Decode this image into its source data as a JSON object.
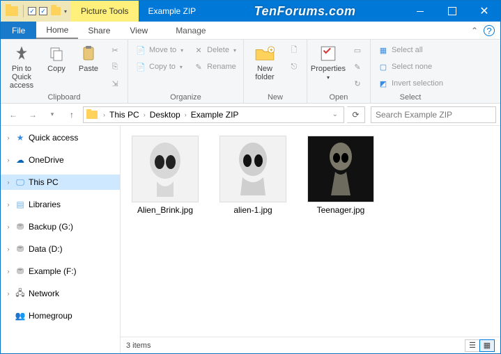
{
  "title": "Example ZIP",
  "context_tab": "Picture Tools",
  "watermark": "TenForums.com",
  "tabs": {
    "file": "File",
    "home": "Home",
    "share": "Share",
    "view": "View",
    "manage": "Manage"
  },
  "ribbon": {
    "clipboard": {
      "label": "Clipboard",
      "pin": "Pin to Quick\naccess",
      "copy": "Copy",
      "paste": "Paste"
    },
    "organize": {
      "label": "Organize",
      "move": "Move to",
      "copy": "Copy to",
      "delete": "Delete",
      "rename": "Rename"
    },
    "new": {
      "label": "New",
      "folder": "New\nfolder"
    },
    "open": {
      "label": "Open",
      "properties": "Properties"
    },
    "select": {
      "label": "Select",
      "all": "Select all",
      "none": "Select none",
      "invert": "Invert selection"
    }
  },
  "breadcrumb": [
    "This PC",
    "Desktop",
    "Example ZIP"
  ],
  "search_placeholder": "Search Example ZIP",
  "nav": [
    {
      "label": "Quick access",
      "icon": "star"
    },
    {
      "label": "OneDrive",
      "icon": "cloud"
    },
    {
      "label": "This PC",
      "icon": "pc",
      "selected": true
    },
    {
      "label": "Libraries",
      "icon": "lib"
    },
    {
      "label": "Backup (G:)",
      "icon": "drive"
    },
    {
      "label": "Data (D:)",
      "icon": "drive"
    },
    {
      "label": "Example (F:)",
      "icon": "drive"
    },
    {
      "label": "Network",
      "icon": "net"
    },
    {
      "label": "Homegroup",
      "icon": "home"
    }
  ],
  "files": [
    {
      "name": "Alien_Brink.jpg",
      "theme": "light"
    },
    {
      "name": "alien-1.jpg",
      "theme": "light"
    },
    {
      "name": "Teenager.jpg",
      "theme": "dark"
    }
  ],
  "status": "3 items"
}
